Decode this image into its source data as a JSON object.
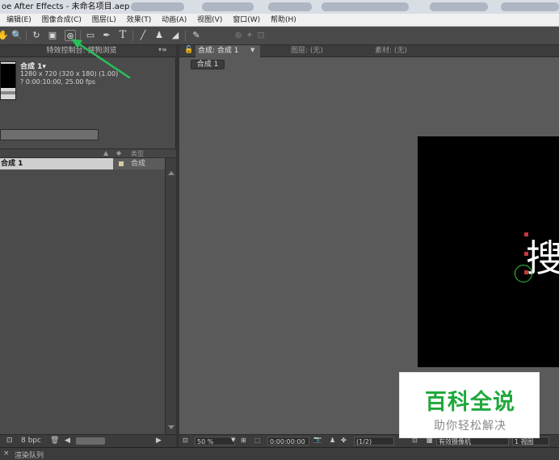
{
  "window": {
    "title": "oe After Effects - 未命名项目.aep *"
  },
  "menu": {
    "items": [
      "编辑(E)",
      "图像合成(C)",
      "图层(L)",
      "效果(T)",
      "动画(A)",
      "视图(V)",
      "窗口(W)",
      "帮助(H)"
    ]
  },
  "toolbar": {
    "icons": [
      "hand-icon",
      "zoom-icon",
      "rotate-icon",
      "camera-icon",
      "pan-behind-icon",
      "rectangle-icon",
      "pen-icon",
      "type-icon",
      "brush-icon",
      "clone-stamp-icon",
      "eraser-icon",
      "puppet-icon"
    ]
  },
  "left_panel": {
    "tab_label": "特效控制台: 搜狗浏览",
    "comp": {
      "name": "合成 1▾",
      "resolution": "1280 x 720  (320 x 180) (1.00)",
      "duration": "? 0:00:10:00, 25.00 fps"
    },
    "columns": {
      "type": "类型"
    },
    "items": [
      {
        "name": "合成 1",
        "type": "合成"
      }
    ],
    "footer": {
      "bpc": "8 bpc"
    }
  },
  "comp_panel": {
    "tabs": {
      "active": "合成: 合成 1",
      "layer": "图层: (无)",
      "footage": "素材: (无)"
    },
    "chip": "合成 1",
    "canvas_text": "搜",
    "bottom": {
      "zoom": "50 %",
      "timecode": "0:00:00:00",
      "resolution": "(1/2)",
      "camera": "有效摄像机",
      "views": "1 视图"
    }
  },
  "status": {
    "tab": "渲染队列"
  },
  "watermark": {
    "title": "百科全说",
    "subtitle": "助你轻松解决"
  },
  "colors": {
    "panel_bg": "#4b4b4b",
    "viewer_bg": "#5a5a5a",
    "watermark_green": "#1fa83c",
    "arrow_green": "#29c05a"
  }
}
